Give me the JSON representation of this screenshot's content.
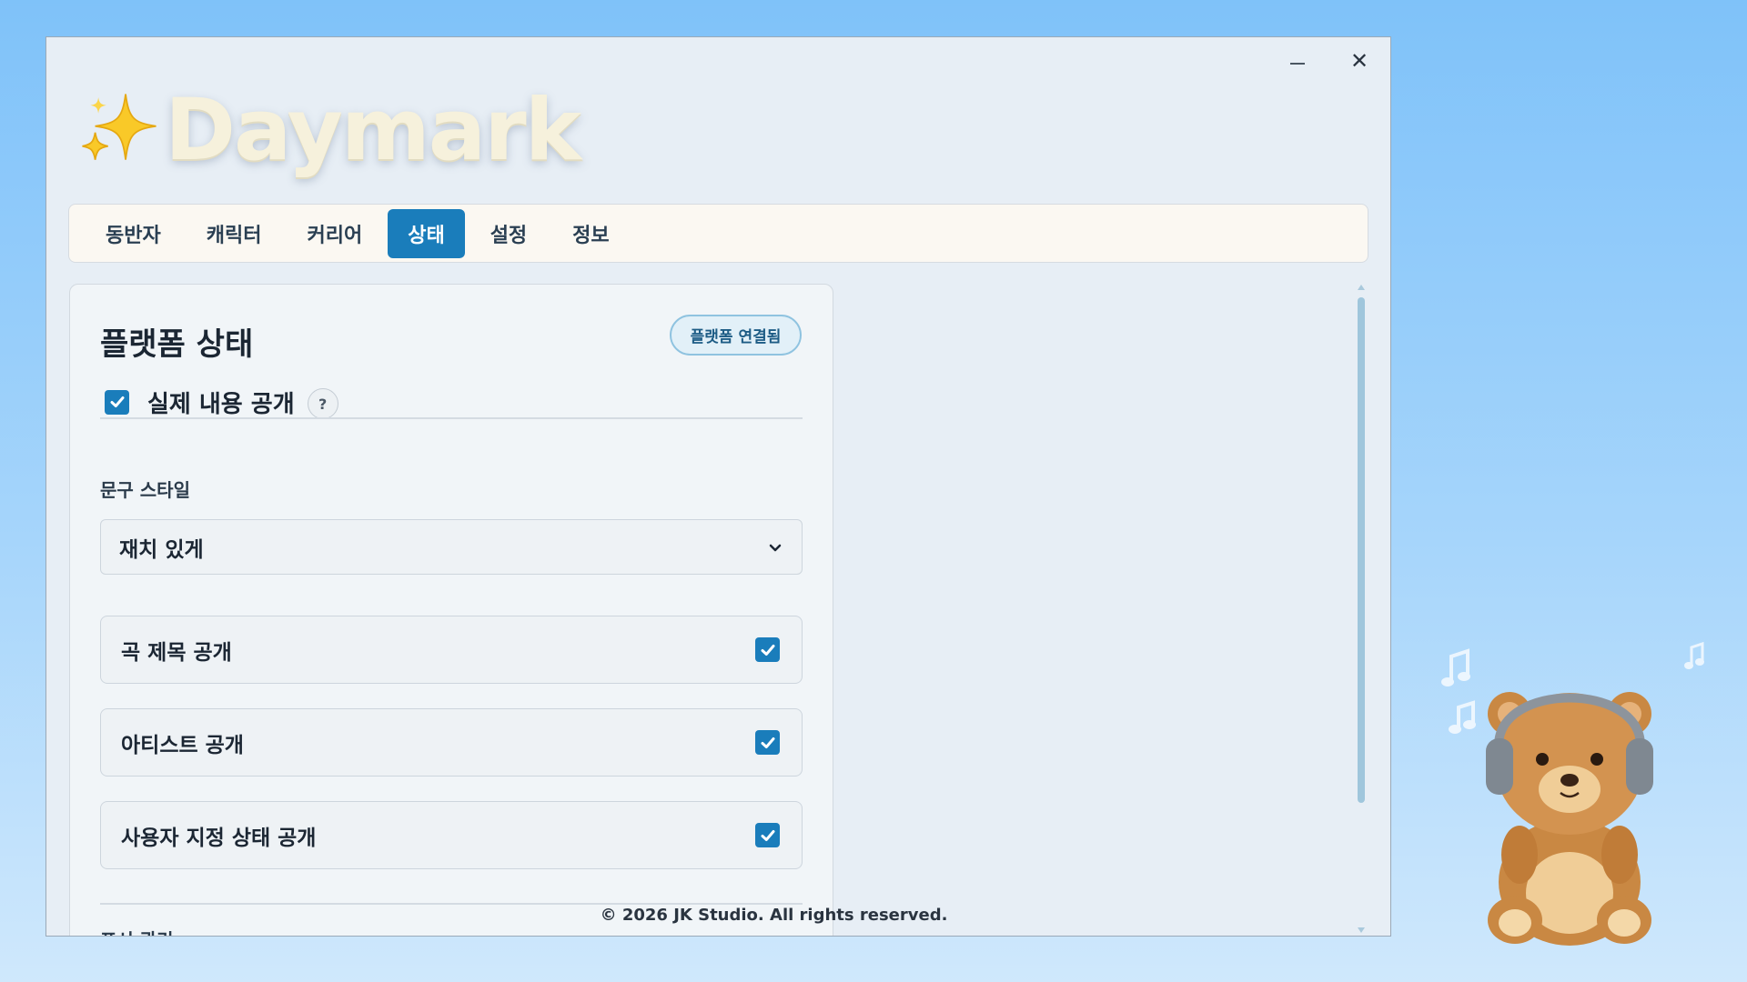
{
  "app": {
    "title": "Daymark",
    "minimize_label": "–",
    "close_label": "✕"
  },
  "tabs": [
    {
      "label": "동반자",
      "active": false
    },
    {
      "label": "캐릭터",
      "active": false
    },
    {
      "label": "커리어",
      "active": false
    },
    {
      "label": "상태",
      "active": true
    },
    {
      "label": "설정",
      "active": false
    },
    {
      "label": "정보",
      "active": false
    }
  ],
  "panel": {
    "title": "플랫폼 상태",
    "badge": "플랫폼 연결됨",
    "reveal": {
      "label": "실제 내용 공개",
      "checked": true,
      "help": "?"
    },
    "phrase_style": {
      "label": "문구 스타일",
      "selected": "재치 있게"
    },
    "toggles": [
      {
        "label": "곡 제목 공개",
        "checked": true
      },
      {
        "label": "아티스트 공개",
        "checked": true
      },
      {
        "label": "사용자 지정 상태 공개",
        "checked": true
      }
    ],
    "next_section_label": "표시 관리"
  },
  "footer": "© 2026 JK Studio. All rights reserved.",
  "colors": {
    "accent": "#1a7dbb",
    "background_top": "#7fc2f9",
    "window": "#e7eef5"
  },
  "icons": [
    "sparkle-icon",
    "close-icon",
    "minimize-icon",
    "help-icon",
    "chevron-down-icon",
    "checkmark-icon",
    "teddy-bear-headphones-icon",
    "music-note-icon"
  ]
}
